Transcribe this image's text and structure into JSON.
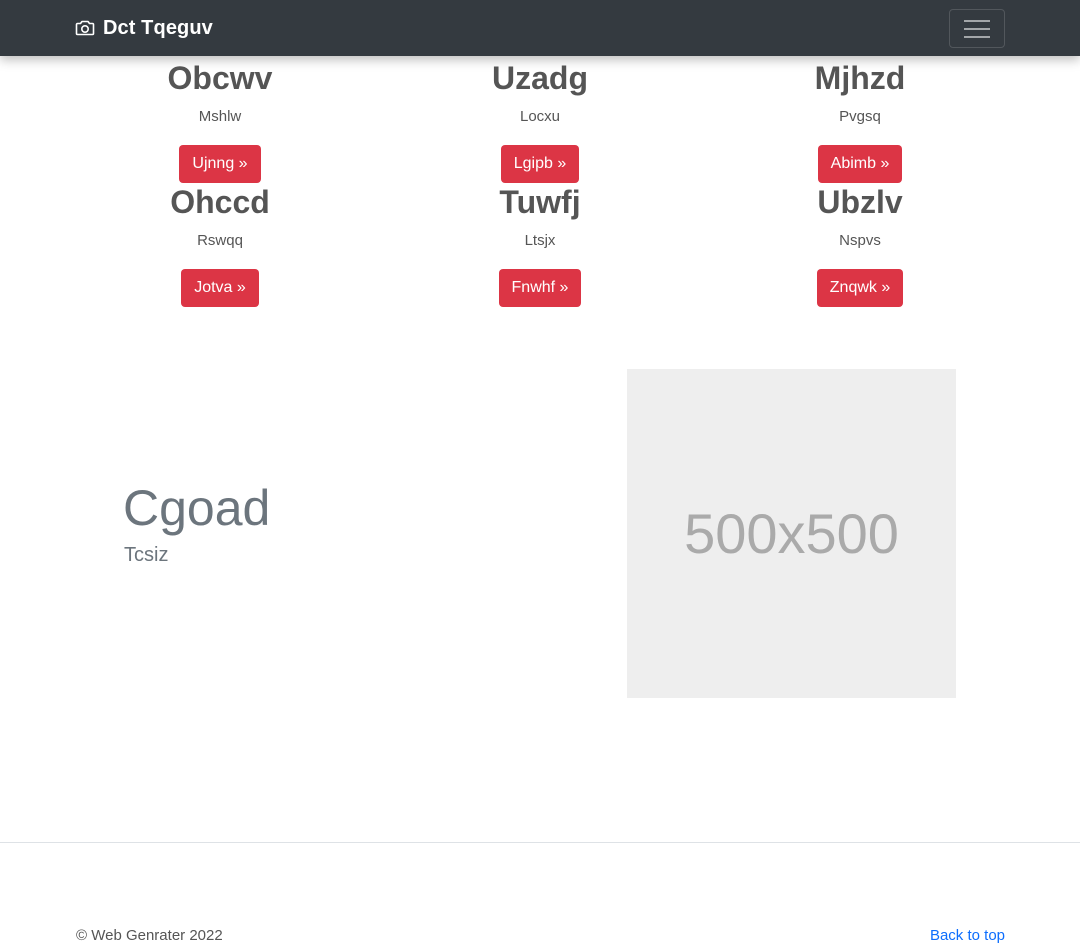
{
  "navbar": {
    "brand": "Dct Tqeguv",
    "brand_icon": "camera-icon",
    "toggler_icon": "hamburger-menu-icon",
    "background": "#343a40"
  },
  "cards": [
    {
      "title": "Obcwv",
      "subtitle": "Mshlw",
      "button": "Ujnng »"
    },
    {
      "title": "Uzadg",
      "subtitle": "Locxu",
      "button": "Lgipb »"
    },
    {
      "title": "Mjhzd",
      "subtitle": "Pvgsq",
      "button": "Abimb »"
    },
    {
      "title": "Ohccd",
      "subtitle": "Rswqq",
      "button": "Jotva »"
    },
    {
      "title": "Tuwfj",
      "subtitle": "Ltsjx",
      "button": "Fnwhf »"
    },
    {
      "title": "Ubzlv",
      "subtitle": "Nspvs",
      "button": "Znqwk »"
    }
  ],
  "button_color": "#dc3545",
  "feature": {
    "title": "Cgoad",
    "subtitle": "Tcsiz",
    "placeholder": "500x500"
  },
  "footer": {
    "copyright": "© Web Genrater 2022",
    "back_to_top": "Back to top",
    "link_color": "#0d6efd"
  }
}
